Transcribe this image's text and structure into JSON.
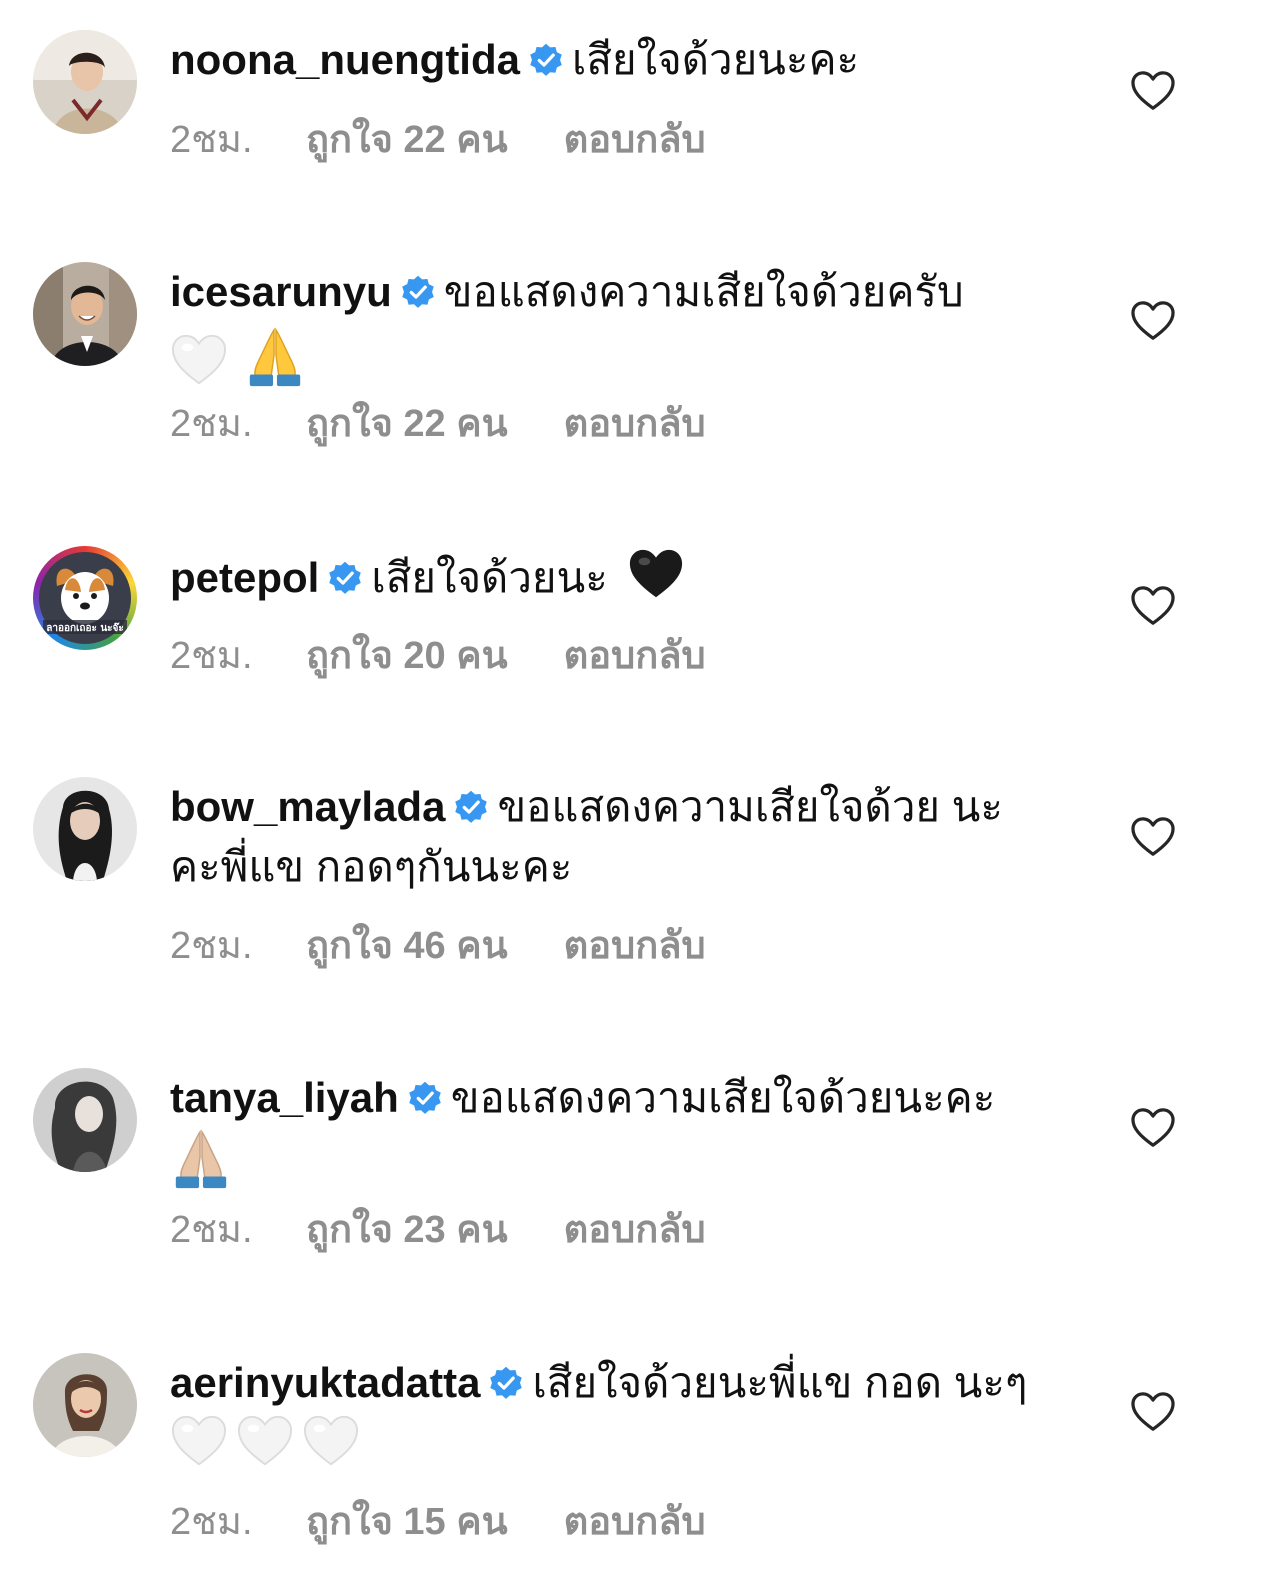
{
  "comments": [
    {
      "username": "noona_nuengtida",
      "text": "เสียใจด้วยนะคะ",
      "emojis": [],
      "time": "2ชม.",
      "likes": "ถูกใจ 22 คน",
      "reply": "ตอบกลับ"
    },
    {
      "username": "icesarunyu",
      "text": "ขอแสดงความเสียใจด้วยครับ",
      "emojis": [
        "white-heart",
        "folded-hands"
      ],
      "time": "2ชม.",
      "likes": "ถูกใจ 22 คน",
      "reply": "ตอบกลับ"
    },
    {
      "username": "petepol",
      "text": "เสียใจด้วยนะ",
      "emojis": [
        "black-heart"
      ],
      "avatar_caption": "ลาออกเถอะ นะจ๊ะ",
      "time": "2ชม.",
      "likes": "ถูกใจ 20 คน",
      "reply": "ตอบกลับ"
    },
    {
      "username": "bow_maylada",
      "text": "ขอแสดงความเสียใจด้วย นะคะพี่แข กอดๆกันนะคะ",
      "emojis": [],
      "time": "2ชม.",
      "likes": "ถูกใจ 46 คน",
      "reply": "ตอบกลับ"
    },
    {
      "username": "tanya_liyah",
      "text": "ขอแสดงความเสียใจด้วยนะคะ",
      "emojis": [
        "folded-hands-light"
      ],
      "time": "2ชม.",
      "likes": "ถูกใจ 23 คน",
      "reply": "ตอบกลับ"
    },
    {
      "username": "aerinyuktadatta",
      "text": "เสียใจด้วยนะพี่แข กอด นะๆ",
      "emojis": [
        "white-heart",
        "white-heart",
        "white-heart"
      ],
      "time": "2ชม.",
      "likes": "ถูกใจ 15 คน",
      "reply": "ตอบกลับ"
    }
  ],
  "colors": {
    "verified_badge": "#3897f0",
    "meta_text": "#8e8e8e",
    "body_text": "#111111"
  },
  "icons": {
    "verified": "verified-badge-icon",
    "like": "heart-outline-icon"
  }
}
